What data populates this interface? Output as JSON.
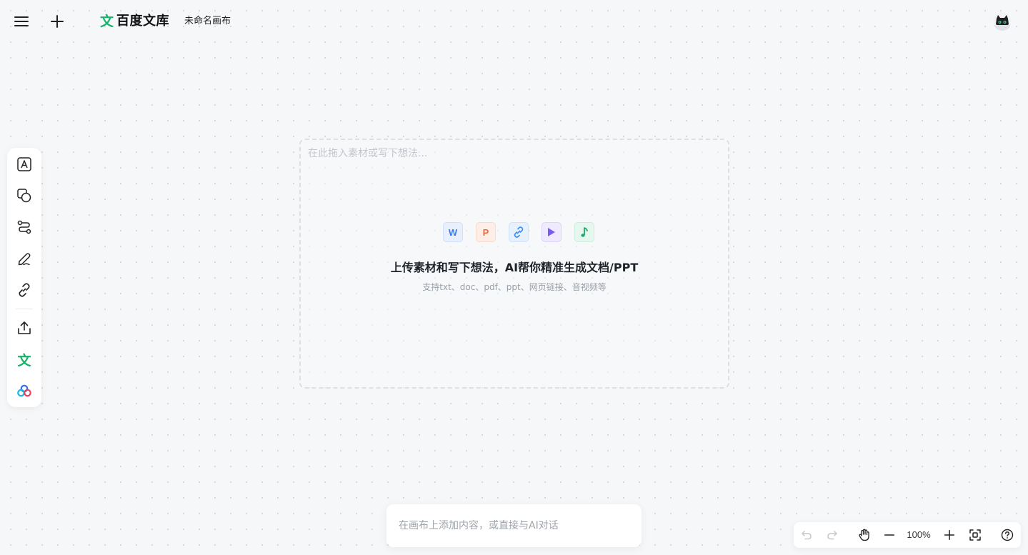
{
  "header": {
    "brand_mark": "文",
    "brand_name": "百度文库",
    "doc_title": "未命名画布",
    "icons": {
      "menu": "menu-icon",
      "new": "plus-icon",
      "avatar": "avatar"
    }
  },
  "left_toolbar": {
    "items": [
      {
        "icon": "text-tool-icon"
      },
      {
        "icon": "shape-tool-icon"
      },
      {
        "icon": "connector-tool-icon"
      },
      {
        "icon": "pen-tool-icon"
      },
      {
        "icon": "link-tool-icon"
      },
      {
        "icon": "upload-icon"
      },
      {
        "icon": "wenku-doc-icon",
        "glyph": "文"
      },
      {
        "icon": "baidu-netdisk-icon"
      }
    ]
  },
  "dropzone": {
    "placeholder": "在此拖入素材或写下想法...",
    "file_icons": [
      {
        "icon": "word-file-icon",
        "glyph": "W"
      },
      {
        "icon": "ppt-file-icon",
        "glyph": "P"
      },
      {
        "icon": "link-file-icon"
      },
      {
        "icon": "video-file-icon"
      },
      {
        "icon": "audio-file-icon"
      }
    ],
    "title": "上传素材和写下想法，AI帮你精准生成文档/PPT",
    "subtitle": "支持txt、doc、pdf、ppt、网页链接、音视频等"
  },
  "chat": {
    "placeholder": "在画布上添加内容，或直接与AI对话"
  },
  "zoom_bar": {
    "zoom_level": "100%",
    "icons": [
      "undo-icon",
      "redo-icon",
      "hand-icon",
      "zoom-out-icon",
      "zoom-in-icon",
      "fit-screen-icon",
      "help-icon"
    ]
  },
  "colors": {
    "brand_green": "#17b26a",
    "canvas_bg": "#f6f7f9",
    "dot": "#d4d7dd"
  }
}
